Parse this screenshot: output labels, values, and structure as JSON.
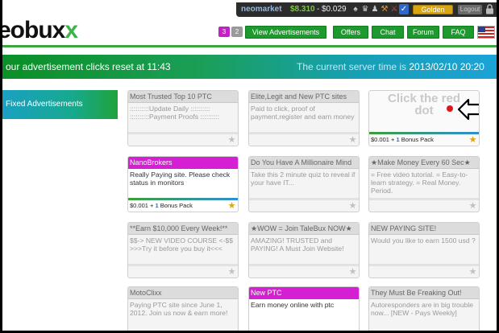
{
  "header": {
    "logo": "eobux",
    "logo_x": "x",
    "username": "neomarket",
    "balance_main": "$8.310",
    "balance_sep": "-",
    "balance_second": "$0.029",
    "golden_label": "Golden",
    "logout_label": "Logout",
    "icons": [
      "person-icon",
      "bank-icon",
      "person2-icon",
      "wrench-icon",
      "tools-icon",
      "shield-icon",
      "lock-icon"
    ]
  },
  "nav": {
    "page_badges": [
      "3",
      "2"
    ],
    "items": [
      "View Advertisements",
      "Offers",
      "Chat",
      "Forum",
      "FAQ"
    ],
    "flag": "us-flag-icon"
  },
  "banner": {
    "left_text": "our advertisement clicks reset at ",
    "left_time": "11:43",
    "right_text": "The current server time is ",
    "right_time": "2013/02/10 20:20"
  },
  "sidebar": {
    "fixed_label": "Fixed Advertisements"
  },
  "ads": [
    {
      "title": "Most Trusted Top 10 PTC",
      "desc": "::::::::::Update Daily ::::::::::\n::::::::::Payment Proofs ::::::::::",
      "footer": null,
      "title_style": "gray"
    },
    {
      "title": "Elite,Legit and New PTC sites",
      "desc": "Paid to click, proof of payment,register and earn money",
      "footer": null,
      "title_style": "gray"
    },
    {
      "title": "Click the red dot",
      "desc": "",
      "footer": {
        "price": "$0.001",
        "plus": "+",
        "count": "1",
        "pack": "Bonus Pack"
      },
      "title_style": "none"
    },
    {
      "title": "NanoBrokers",
      "desc": "Really Paying site. Please check status in monitors",
      "footer": {
        "price": "$0.001",
        "plus": "+",
        "count": "1",
        "pack": "Bonus Pack"
      },
      "title_style": "magenta"
    },
    {
      "title": "Do You Have A Millionaire Mind",
      "desc": "Take this 2 minute quiz to reveal if your have IT...",
      "footer": null,
      "title_style": "gray"
    },
    {
      "title": "★Make Money Every 60 Sec★",
      "desc": "= Free video tutorial. = Easy-to-learn strategy. = Real Money. Period.",
      "footer": null,
      "title_style": "gray"
    },
    {
      "title": "**Earn $10,000 Every Week!**",
      "desc": "$$-> NEW VIDEO COURSE <-$$\n>>>Try it before you buy it<<<",
      "footer": null,
      "title_style": "gray"
    },
    {
      "title": "★WOW = Join TaleBux NOW★",
      "desc": "AMAZING! TRUSTED and PAYING! A Must Join Website!",
      "footer": null,
      "title_style": "gray"
    },
    {
      "title": "NEW PAYING SITE!",
      "desc": "Would you like to earn 1500 usd ?",
      "footer": null,
      "title_style": "gray"
    },
    {
      "title": "MotoClixx",
      "desc": "Paying PTC site since June 1, 2012. Join us now & earn more!",
      "footer": null,
      "title_style": "gray"
    },
    {
      "title": "New PTC",
      "desc": "Earn money online with ptc",
      "footer": null,
      "title_style": "magenta"
    },
    {
      "title": "They Must Be Freaking Out!",
      "desc": "Autoresponders are in big trouble now... [NEW - Pays Weekly]",
      "footer": null,
      "title_style": "gray"
    }
  ],
  "click_red": {
    "line1": "Click the red",
    "line2": "dot"
  },
  "colors": {
    "accent_green": "#1c9a2d",
    "magenta": "#d41fd2",
    "gold": "#d9a514",
    "red_dot": "#e01616"
  }
}
